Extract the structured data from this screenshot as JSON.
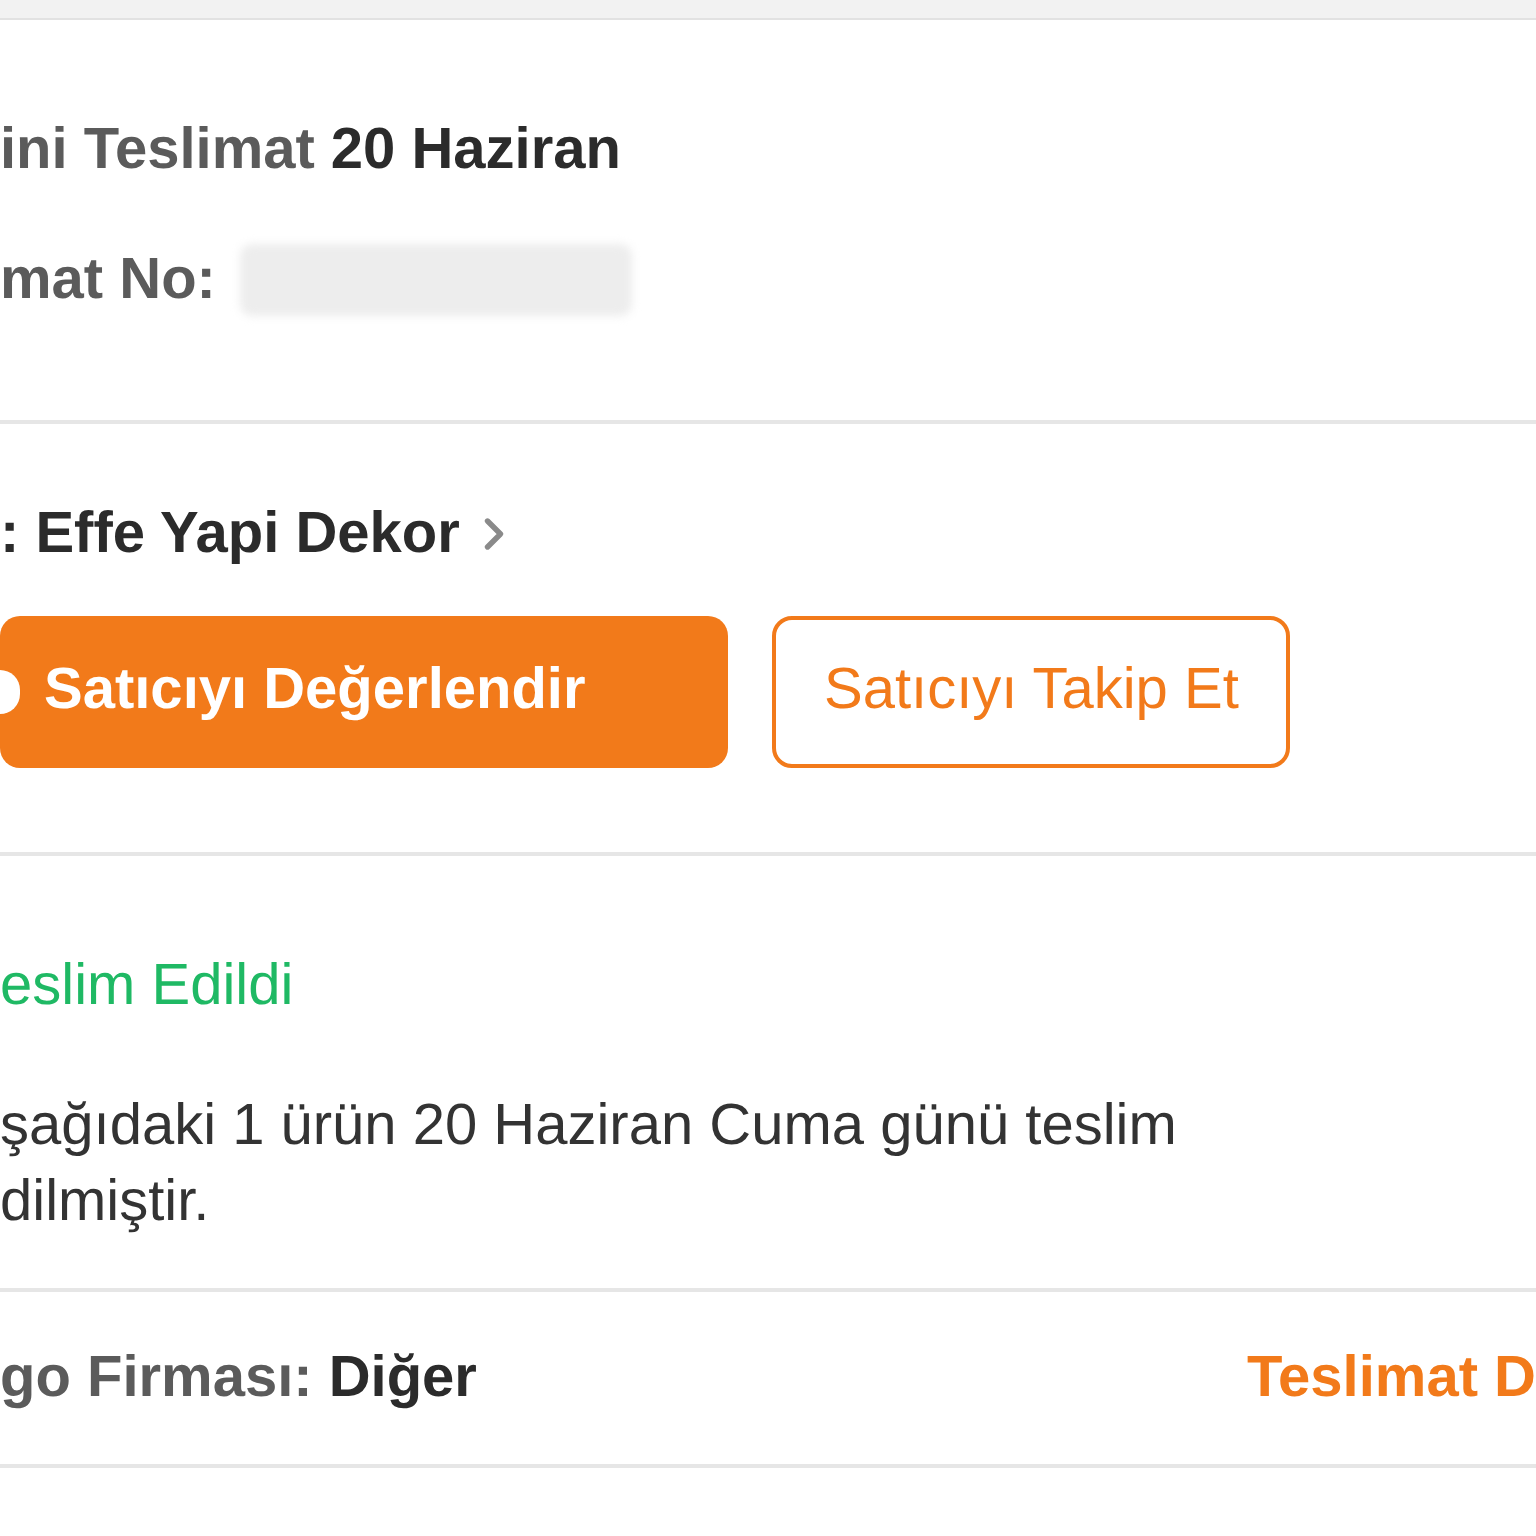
{
  "delivery": {
    "label": "ini Teslimat",
    "date": "20 Haziran",
    "number_label": "mat No:"
  },
  "seller": {
    "label": ": Effe Yapi Dekor"
  },
  "seller_buttons": [
    {
      "label": "Satıcıyı Değerlendir",
      "kind": "filled"
    },
    {
      "label": "Satıcıyı Takip Et",
      "kind": "outline"
    }
  ],
  "status": {
    "label": "eslim Edildi",
    "message_lines": [
      "şağıdaki 1 ürün 20 Haziran Cuma günü teslim",
      "dilmiştir."
    ]
  },
  "cargo": {
    "label": "go Firması:",
    "value": "Diğer",
    "link": "Teslimat D"
  }
}
